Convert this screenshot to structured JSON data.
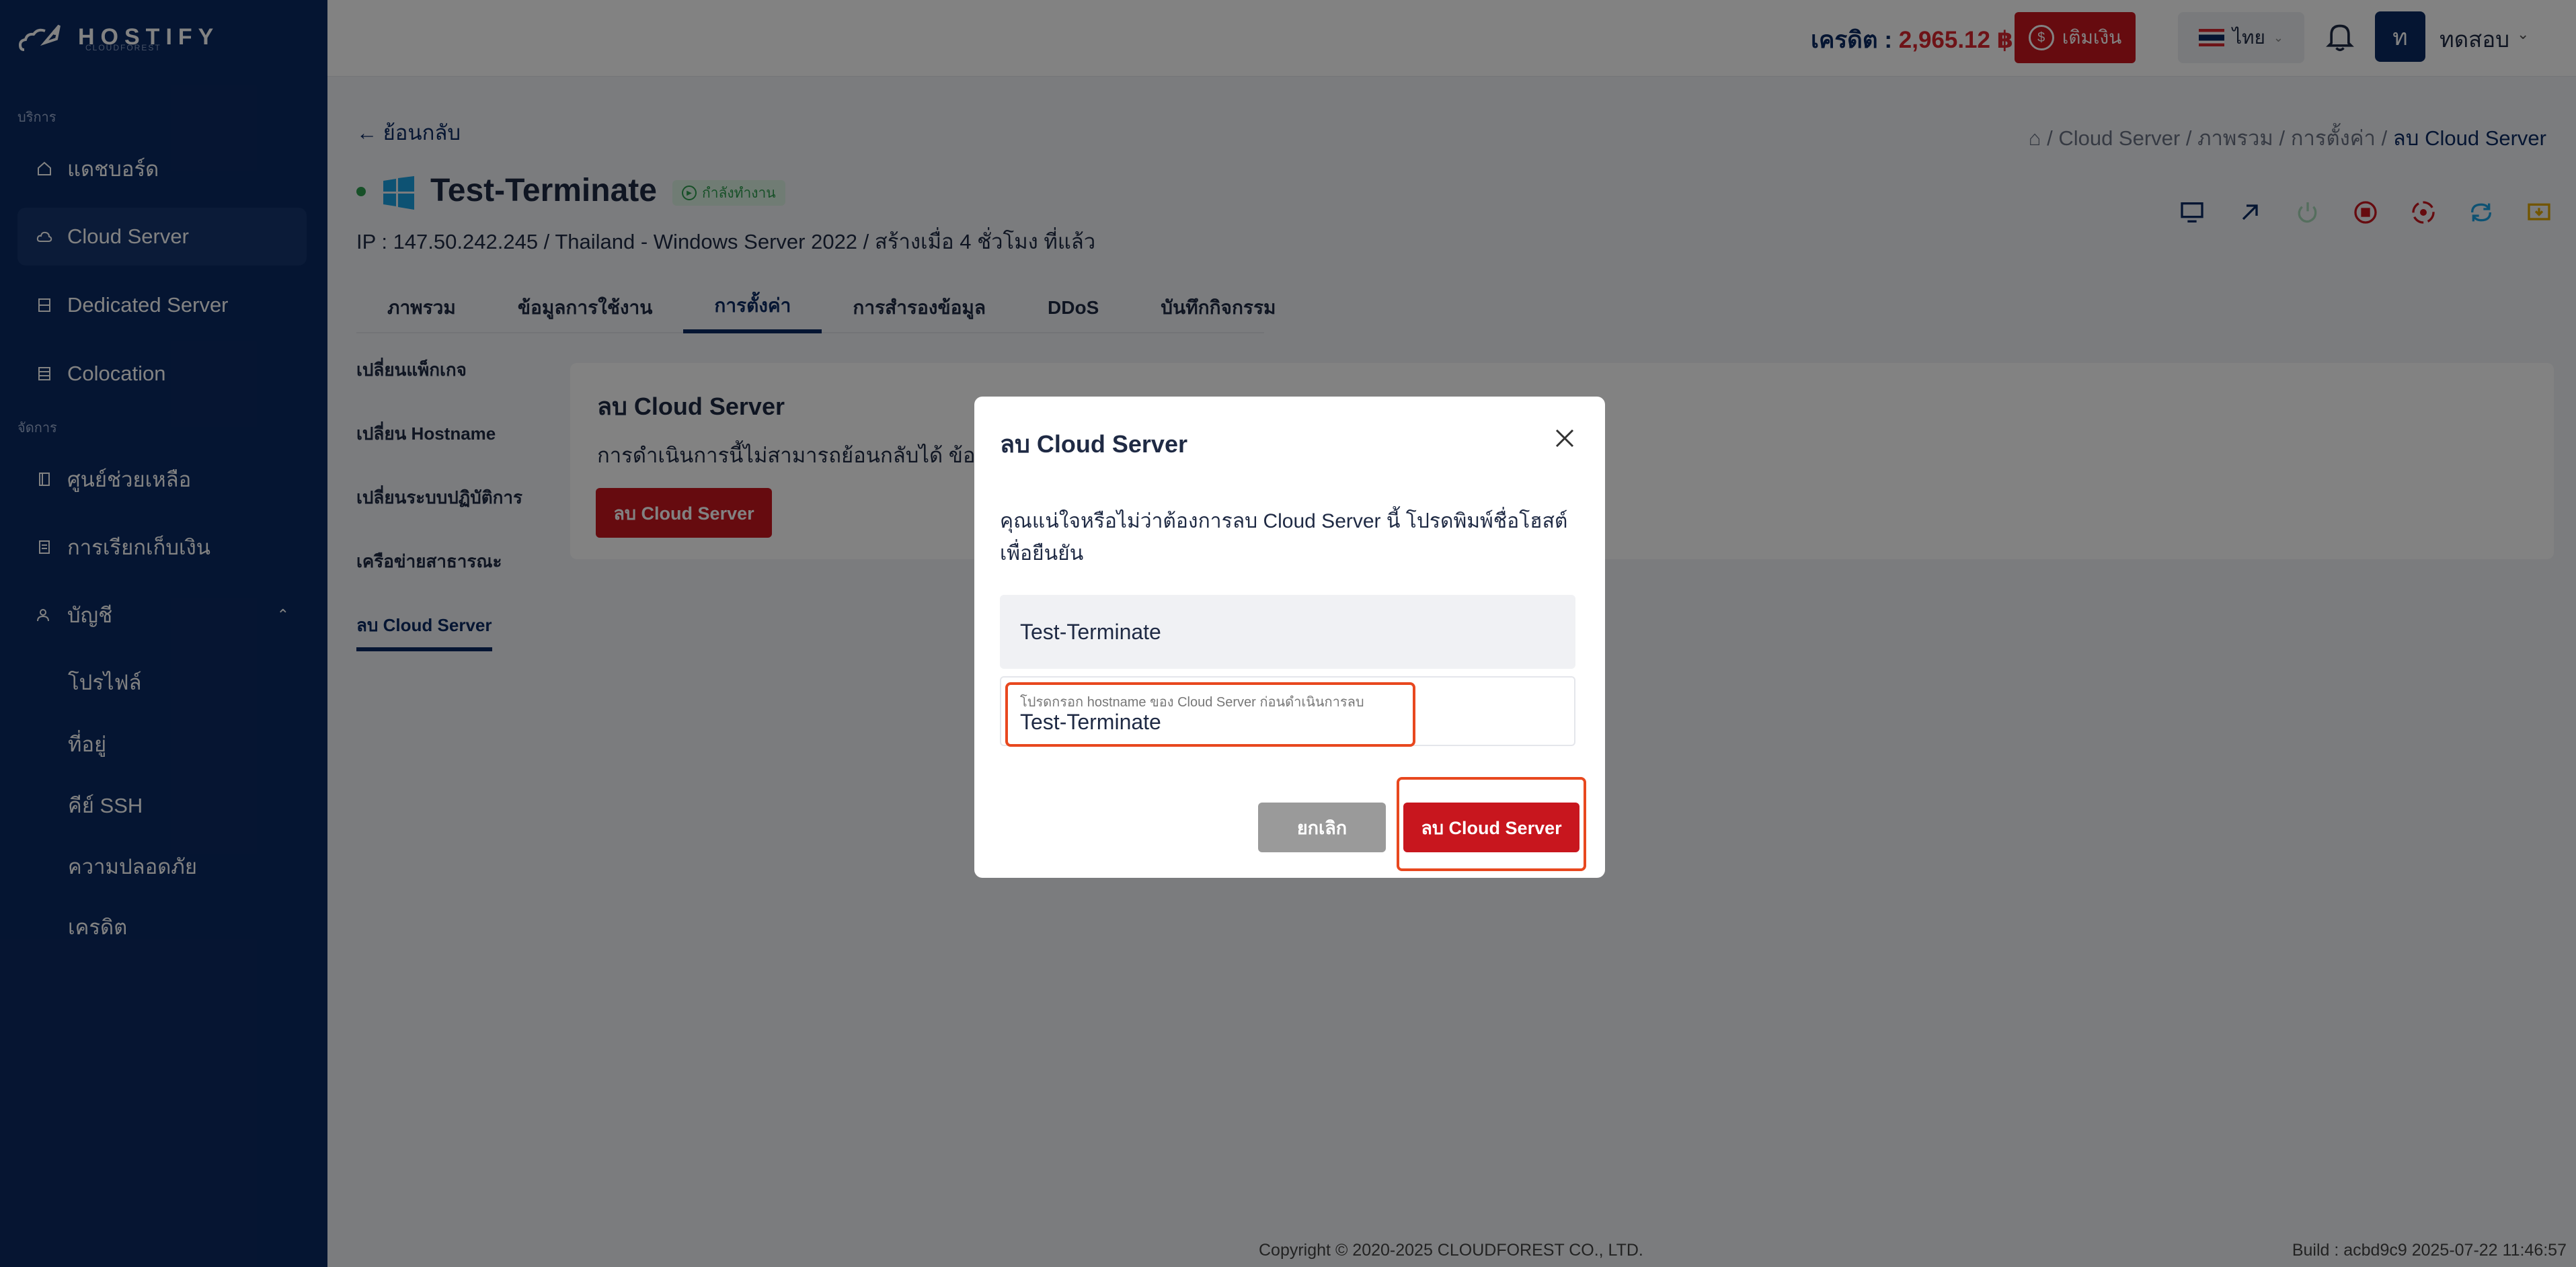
{
  "brand": {
    "name": "HOSTIFY",
    "tagline": "CLOUDFOREST"
  },
  "sidebar": {
    "section_services": "บริการ",
    "section_manage": "จัดการ",
    "items": [
      {
        "label": "แดชบอร์ด",
        "icon": "home-icon"
      },
      {
        "label": "Cloud Server",
        "icon": "cloud-icon",
        "active": true
      },
      {
        "label": "Dedicated Server",
        "icon": "server-icon"
      },
      {
        "label": "Colocation",
        "icon": "rack-icon"
      },
      {
        "label": "ศูนย์ช่วยเหลือ",
        "icon": "book-icon"
      },
      {
        "label": "การเรียกเก็บเงิน",
        "icon": "receipt-icon"
      },
      {
        "label": "บัญชี",
        "icon": "users-icon",
        "expanded": true
      }
    ],
    "account_sub": [
      "โปรไฟล์",
      "ที่อยู่",
      "คีย์ SSH",
      "ความปลอดภัย",
      "เครดิต"
    ]
  },
  "header": {
    "credit_label": "เครดิต :",
    "credit_value": "2,965.12 ฿",
    "topup_label": "เติมเงิน",
    "language": "ไทย",
    "avatar_letter": "ท",
    "user_name": "ทดสอบ"
  },
  "page": {
    "back_label": "← ย้อนกลับ",
    "breadcrumb": [
      "Cloud Server",
      "ภาพรวม",
      "การตั้งค่า"
    ],
    "breadcrumb_current": "ลบ Cloud Server",
    "server_name": "Test-Terminate",
    "status": "กำลังทำงาน",
    "meta": "IP : 147.50.242.245 / Thailand - Windows Server 2022 / สร้างเมื่อ 4 ชั่วโมง ที่แล้ว",
    "tabs": [
      "ภาพรวม",
      "ข้อมูลการใช้งาน",
      "การตั้งค่า",
      "การสำรองข้อมูล",
      "DDoS",
      "บันทึกกิจกรรม"
    ],
    "settings_nav": [
      "เปลี่ยนแพ็กเกจ",
      "เปลี่ยน Hostname",
      "เปลี่ยนระบบปฏิบัติการ",
      "เครือข่ายสาธารณะ",
      "ลบ Cloud Server"
    ],
    "card_title": "ลบ Cloud Server",
    "card_text": "การดำเนินการนี้ไม่สามารถย้อนกลับได้ ข้อมูลของ",
    "card_button": "ลบ Cloud Server"
  },
  "modal": {
    "title": "ลบ Cloud Server",
    "text": "คุณแน่ใจหรือไม่ว่าต้องการลบ Cloud Server นี้ โปรดพิมพ์ชื่อโฮสต์เพื่อยืนยัน",
    "hostname": "Test-Terminate",
    "input_label": "โปรดกรอก hostname ของ Cloud Server ก่อนดำเนินการลบ",
    "input_value": "Test-Terminate",
    "cancel": "ยกเลิก",
    "confirm": "ลบ Cloud Server"
  },
  "footer": {
    "copyright": "Copyright © 2020-2025 CLOUDFOREST CO., LTD.",
    "build": "Build : acbd9c9 2025-07-22 11:46:57"
  },
  "colors": {
    "navy": "#0b2a63",
    "danger": "#c8161e",
    "success": "#2e9d4f",
    "highlight": "#e8481f"
  }
}
